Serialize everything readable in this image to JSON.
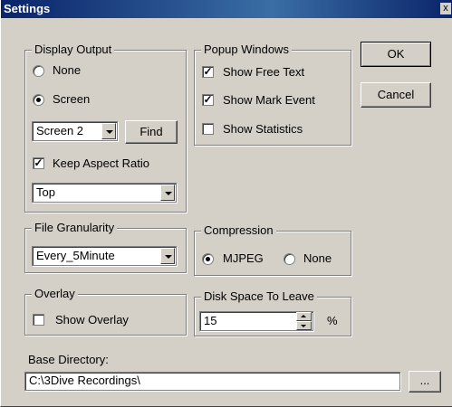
{
  "window": {
    "title": "Settings",
    "close_glyph": "x"
  },
  "display_output": {
    "legend": "Display Output",
    "radio_none": "None",
    "radio_screen": "Screen",
    "selected": "Screen",
    "screen_select": "Screen 2",
    "find_button": "Find",
    "keep_aspect_label": "Keep Aspect Ratio",
    "keep_aspect_checked": true,
    "position_select": "Top"
  },
  "popup_windows": {
    "legend": "Popup Windows",
    "items": [
      {
        "label": "Show Free Text",
        "checked": true
      },
      {
        "label": "Show Mark Event",
        "checked": true
      },
      {
        "label": "Show Statistics",
        "checked": false
      }
    ]
  },
  "buttons": {
    "ok": "OK",
    "cancel": "Cancel",
    "browse": "..."
  },
  "file_granularity": {
    "legend": "File Granularity",
    "value": "Every_5Minute"
  },
  "compression": {
    "legend": "Compression",
    "opt1": "MJPEG",
    "opt2": "None",
    "selected": "MJPEG"
  },
  "overlay": {
    "legend": "Overlay",
    "label": "Show Overlay",
    "checked": false
  },
  "disk_space": {
    "legend": "Disk Space To Leave",
    "value": "15",
    "unit": "%"
  },
  "base_directory": {
    "label": "Base Directory:",
    "value": "C:\\3Dive Recordings\\"
  },
  "colors": {
    "titlebar": "#0a246a",
    "face": "#d4d0c8"
  },
  "icons": {
    "checkmark": "check-icon",
    "dropdown": "dropdown-arrow-icon",
    "spin_up": "spin-up-icon",
    "spin_down": "spin-down-icon"
  }
}
